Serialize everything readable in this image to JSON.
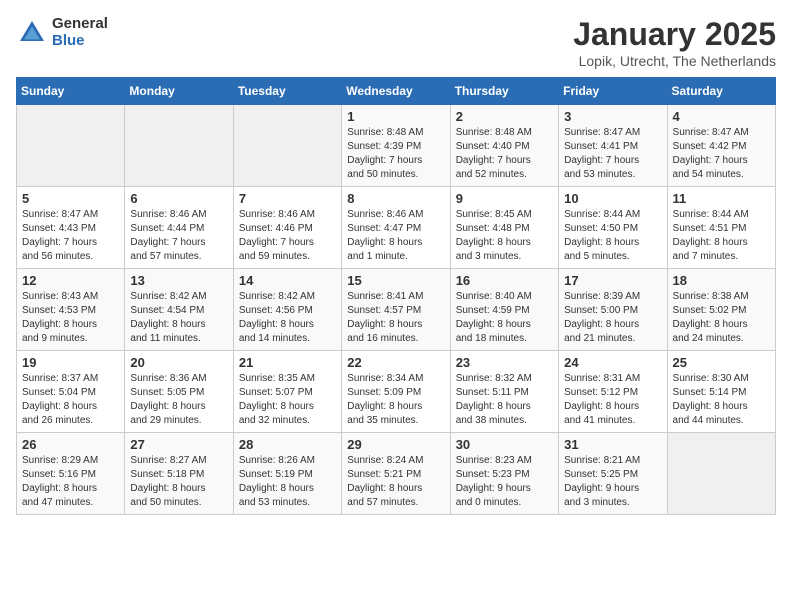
{
  "logo": {
    "general": "General",
    "blue": "Blue"
  },
  "title": "January 2025",
  "subtitle": "Lopik, Utrecht, The Netherlands",
  "days_of_week": [
    "Sunday",
    "Monday",
    "Tuesday",
    "Wednesday",
    "Thursday",
    "Friday",
    "Saturday"
  ],
  "weeks": [
    [
      {
        "day": "",
        "info": ""
      },
      {
        "day": "",
        "info": ""
      },
      {
        "day": "",
        "info": ""
      },
      {
        "day": "1",
        "info": "Sunrise: 8:48 AM\nSunset: 4:39 PM\nDaylight: 7 hours\nand 50 minutes."
      },
      {
        "day": "2",
        "info": "Sunrise: 8:48 AM\nSunset: 4:40 PM\nDaylight: 7 hours\nand 52 minutes."
      },
      {
        "day": "3",
        "info": "Sunrise: 8:47 AM\nSunset: 4:41 PM\nDaylight: 7 hours\nand 53 minutes."
      },
      {
        "day": "4",
        "info": "Sunrise: 8:47 AM\nSunset: 4:42 PM\nDaylight: 7 hours\nand 54 minutes."
      }
    ],
    [
      {
        "day": "5",
        "info": "Sunrise: 8:47 AM\nSunset: 4:43 PM\nDaylight: 7 hours\nand 56 minutes."
      },
      {
        "day": "6",
        "info": "Sunrise: 8:46 AM\nSunset: 4:44 PM\nDaylight: 7 hours\nand 57 minutes."
      },
      {
        "day": "7",
        "info": "Sunrise: 8:46 AM\nSunset: 4:46 PM\nDaylight: 7 hours\nand 59 minutes."
      },
      {
        "day": "8",
        "info": "Sunrise: 8:46 AM\nSunset: 4:47 PM\nDaylight: 8 hours\nand 1 minute."
      },
      {
        "day": "9",
        "info": "Sunrise: 8:45 AM\nSunset: 4:48 PM\nDaylight: 8 hours\nand 3 minutes."
      },
      {
        "day": "10",
        "info": "Sunrise: 8:44 AM\nSunset: 4:50 PM\nDaylight: 8 hours\nand 5 minutes."
      },
      {
        "day": "11",
        "info": "Sunrise: 8:44 AM\nSunset: 4:51 PM\nDaylight: 8 hours\nand 7 minutes."
      }
    ],
    [
      {
        "day": "12",
        "info": "Sunrise: 8:43 AM\nSunset: 4:53 PM\nDaylight: 8 hours\nand 9 minutes."
      },
      {
        "day": "13",
        "info": "Sunrise: 8:42 AM\nSunset: 4:54 PM\nDaylight: 8 hours\nand 11 minutes."
      },
      {
        "day": "14",
        "info": "Sunrise: 8:42 AM\nSunset: 4:56 PM\nDaylight: 8 hours\nand 14 minutes."
      },
      {
        "day": "15",
        "info": "Sunrise: 8:41 AM\nSunset: 4:57 PM\nDaylight: 8 hours\nand 16 minutes."
      },
      {
        "day": "16",
        "info": "Sunrise: 8:40 AM\nSunset: 4:59 PM\nDaylight: 8 hours\nand 18 minutes."
      },
      {
        "day": "17",
        "info": "Sunrise: 8:39 AM\nSunset: 5:00 PM\nDaylight: 8 hours\nand 21 minutes."
      },
      {
        "day": "18",
        "info": "Sunrise: 8:38 AM\nSunset: 5:02 PM\nDaylight: 8 hours\nand 24 minutes."
      }
    ],
    [
      {
        "day": "19",
        "info": "Sunrise: 8:37 AM\nSunset: 5:04 PM\nDaylight: 8 hours\nand 26 minutes."
      },
      {
        "day": "20",
        "info": "Sunrise: 8:36 AM\nSunset: 5:05 PM\nDaylight: 8 hours\nand 29 minutes."
      },
      {
        "day": "21",
        "info": "Sunrise: 8:35 AM\nSunset: 5:07 PM\nDaylight: 8 hours\nand 32 minutes."
      },
      {
        "day": "22",
        "info": "Sunrise: 8:34 AM\nSunset: 5:09 PM\nDaylight: 8 hours\nand 35 minutes."
      },
      {
        "day": "23",
        "info": "Sunrise: 8:32 AM\nSunset: 5:11 PM\nDaylight: 8 hours\nand 38 minutes."
      },
      {
        "day": "24",
        "info": "Sunrise: 8:31 AM\nSunset: 5:12 PM\nDaylight: 8 hours\nand 41 minutes."
      },
      {
        "day": "25",
        "info": "Sunrise: 8:30 AM\nSunset: 5:14 PM\nDaylight: 8 hours\nand 44 minutes."
      }
    ],
    [
      {
        "day": "26",
        "info": "Sunrise: 8:29 AM\nSunset: 5:16 PM\nDaylight: 8 hours\nand 47 minutes."
      },
      {
        "day": "27",
        "info": "Sunrise: 8:27 AM\nSunset: 5:18 PM\nDaylight: 8 hours\nand 50 minutes."
      },
      {
        "day": "28",
        "info": "Sunrise: 8:26 AM\nSunset: 5:19 PM\nDaylight: 8 hours\nand 53 minutes."
      },
      {
        "day": "29",
        "info": "Sunrise: 8:24 AM\nSunset: 5:21 PM\nDaylight: 8 hours\nand 57 minutes."
      },
      {
        "day": "30",
        "info": "Sunrise: 8:23 AM\nSunset: 5:23 PM\nDaylight: 9 hours\nand 0 minutes."
      },
      {
        "day": "31",
        "info": "Sunrise: 8:21 AM\nSunset: 5:25 PM\nDaylight: 9 hours\nand 3 minutes."
      },
      {
        "day": "",
        "info": ""
      }
    ]
  ]
}
